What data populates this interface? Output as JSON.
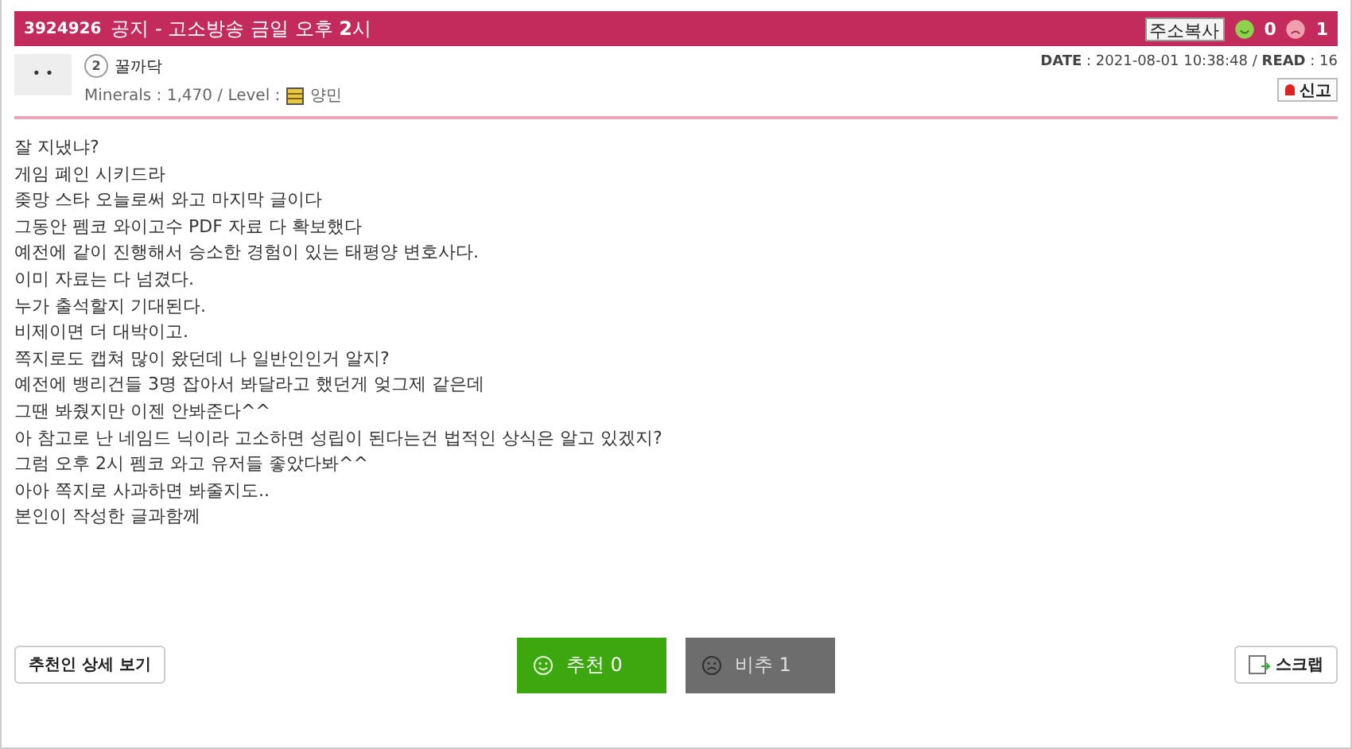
{
  "post": {
    "number": "3924926",
    "title": "공지 - 고소방송 금일 오후 **2**시",
    "copy_button": "주소복사",
    "likes": "0",
    "dislikes": "1"
  },
  "author": {
    "avatar_face": "• •",
    "rank": "2",
    "name": "꿀까닥",
    "minerals_label": "Minerals : 1,470 / Level :",
    "level_name": "양민"
  },
  "meta": {
    "date_read": "**DATE** : 2021-08-01 10:38:48 / **READ** : 16",
    "report_button": "신고"
  },
  "body": [
    "잘 지냈냐?",
    "게임 폐인 시키드라",
    "좆망 스타 오늘로써 와고 마지막 글이다",
    "그동안 펨코 와이고수 PDF 자료 다 확보했다",
    "예전에 같이 진행해서 승소한 경험이 있는 태평양 변호사다.",
    "이미 자료는 다 넘겼다.",
    "누가 출석할지 기대된다.",
    "비제이면 더 대박이고.",
    "쪽지로도 캡쳐 많이 왔던데 나 일반인인거 알지?",
    "예전에 뱅리건들 3명 잡아서 봐달라고 했던게 엊그제 같은데",
    "그땐 봐줬지만 이젠 안봐준다^^",
    "아 참고로 난 네임드 닉이라 고소하면 성립이 된다는건 법적인 상식은 알고 있겠지?",
    "그럼 오후 2시 펨코 와고 유저들 좋았다봐^^",
    "아아 쪽지로 사과하면 봐줄지도..",
    "본인이 작성한 글과함께"
  ],
  "footer": {
    "voters_button": "추천인 상세 보기",
    "votes": [
      {
        "kind": "up",
        "label": "추천 0"
      },
      {
        "kind": "down",
        "label": "비추 1"
      }
    ],
    "scrap_button": "스크랩"
  }
}
